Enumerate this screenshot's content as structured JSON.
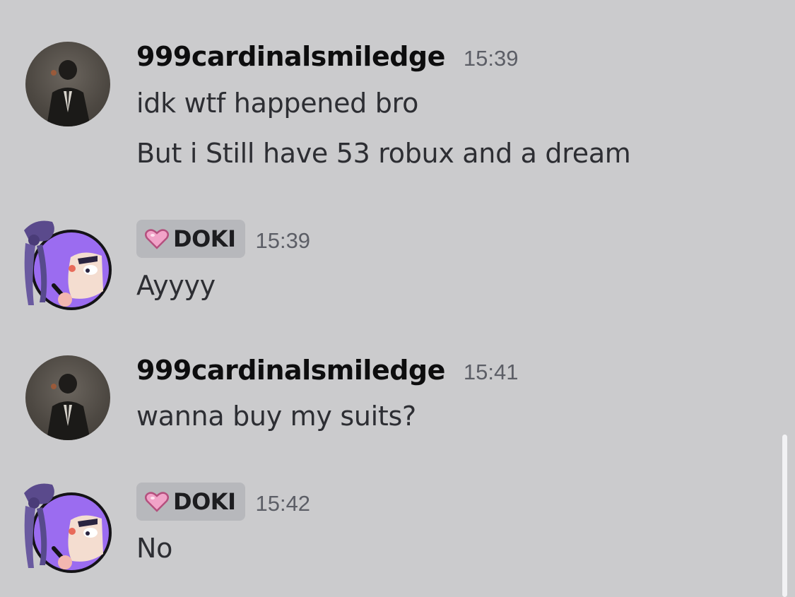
{
  "colors": {
    "background": "#cbcbcd",
    "username": "#0d0d0e",
    "message_text": "#2d2e33",
    "timestamp": "#5c5e66",
    "tag_background": "#b7b8bc",
    "doki_purple": "#9b6cf0",
    "heart_pink": "#f1a3c8"
  },
  "messages": [
    {
      "author": "999cardinalsmiledge",
      "avatar_icon": "photo-avatar",
      "time": "15:39",
      "lines": [
        "idk wtf happened bro",
        "But i Still have 53 robux and a dream"
      ]
    },
    {
      "author": "DOKI",
      "author_tag_icon": "pink-heart-icon",
      "avatar_icon": "doki-avatar",
      "time": "15:39",
      "lines": [
        "Ayyyy"
      ]
    },
    {
      "author": "999cardinalsmiledge",
      "avatar_icon": "photo-avatar",
      "time": "15:41",
      "lines": [
        "wanna buy my suits?"
      ]
    },
    {
      "author": "DOKI",
      "author_tag_icon": "pink-heart-icon",
      "avatar_icon": "doki-avatar",
      "time": "15:42",
      "lines": [
        "No"
      ]
    }
  ]
}
